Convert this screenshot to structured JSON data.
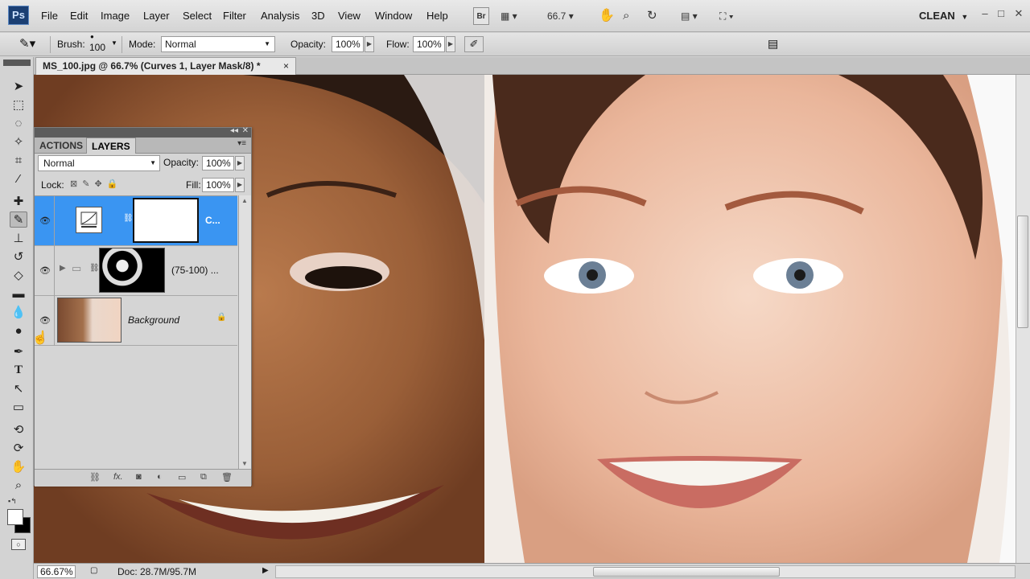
{
  "app": {
    "logo": "Ps",
    "workspace": "CLEAN"
  },
  "menu": [
    "File",
    "Edit",
    "Image",
    "Layer",
    "Select",
    "Filter",
    "Analysis",
    "3D",
    "View",
    "Window",
    "Help"
  ],
  "appbar": {
    "bridge_label": "Br",
    "zoom": "66.7"
  },
  "options": {
    "brush_label": "Brush:",
    "brush_size": "100",
    "mode_label": "Mode:",
    "mode_value": "Normal",
    "opacity_label": "Opacity:",
    "opacity_value": "100%",
    "flow_label": "Flow:",
    "flow_value": "100%"
  },
  "document": {
    "tab_title": "MS_100.jpg @ 66.7% (Curves 1, Layer Mask/8) *",
    "close": "×"
  },
  "status": {
    "zoom": "66.67%",
    "doc_info": "Doc: 28.7M/95.7M"
  },
  "panel": {
    "tabs": [
      "ACTIONS",
      "LAYERS"
    ],
    "active_tab": "LAYERS",
    "blend_mode": "Normal",
    "opacity_label": "Opacity:",
    "opacity_value": "100%",
    "lock_label": "Lock:",
    "fill_label": "Fill:",
    "fill_value": "100%",
    "layers": [
      {
        "name": "C...",
        "selected": true
      },
      {
        "name": "(75-100) ...",
        "selected": false
      },
      {
        "name": "Background",
        "selected": false
      }
    ]
  },
  "colors": {
    "selection": "#3a95f2",
    "logo_bg": "#1b3f73"
  }
}
